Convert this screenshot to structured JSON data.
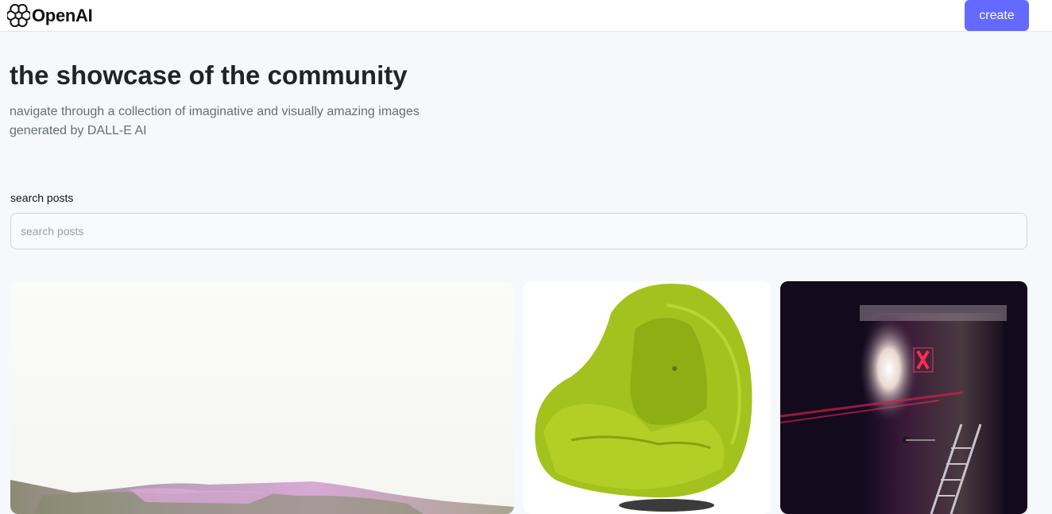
{
  "header": {
    "brand_name": "OpenAI",
    "logo_icon": "openai-logo-icon",
    "create_label": "create",
    "accent_color": "#6469ff"
  },
  "hero": {
    "title": "the showcase of the community",
    "subtitle": "navigate through a collection of imaginative and visually amazing images generated by DALL-E AI"
  },
  "search": {
    "label": "search posts",
    "placeholder": "search posts",
    "value": ""
  },
  "gallery": {
    "cards": [
      {
        "subject": "pink-green-hills-image"
      },
      {
        "subject": "lime-green-armchair-image"
      },
      {
        "subject": "dark-room-neon-x-image"
      }
    ]
  }
}
